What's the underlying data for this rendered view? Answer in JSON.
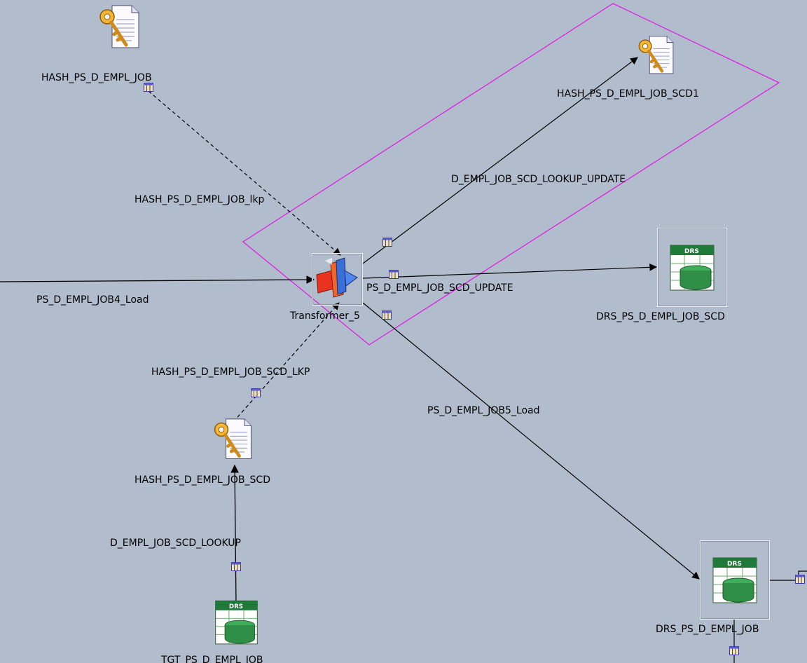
{
  "canvas": {
    "background": "#b1bccd",
    "selection_color": "#e020e0"
  },
  "stages": {
    "hash_empl_job": {
      "label": "HASH_PS_D_EMPL_JOB",
      "icon": "hashed-file-key-icon"
    },
    "hash_empl_job_scd1": {
      "label": "HASH_PS_D_EMPL_JOB_SCD1",
      "icon": "hashed-file-key-icon"
    },
    "transformer": {
      "label": "Transformer_5",
      "icon": "transformer-icon"
    },
    "drs_empl_job_scd": {
      "label": "DRS_PS_D_EMPL_JOB_SCD",
      "icon": "drs-database-icon",
      "badge": "DRS"
    },
    "hash_empl_job_scd": {
      "label": "HASH_PS_D_EMPL_JOB_SCD",
      "icon": "hashed-file-key-icon"
    },
    "tgt_empl_job": {
      "label": "TGT_PS_D_EMPL_JOB",
      "icon": "drs-database-icon",
      "badge": "DRS"
    },
    "drs_empl_job": {
      "label": "DRS_PS_D_EMPL_JOB",
      "icon": "drs-database-icon",
      "badge": "DRS"
    }
  },
  "links": {
    "lkp": "HASH_PS_D_EMPL_JOB_lkp",
    "lookup_update": "D_EMPL_JOB_SCD_LOOKUP_UPDATE",
    "load4": "PS_D_EMPL_JOB4_Load",
    "scd_update": "PS_D_EMPL_JOB_SCD_UPDATE",
    "scd_lkp": "HASH_PS_D_EMPL_JOB_SCD_LKP",
    "load5": "PS_D_EMPL_JOB5_Load",
    "scd_lookup": "D_EMPL_JOB_SCD_LOOKUP"
  }
}
